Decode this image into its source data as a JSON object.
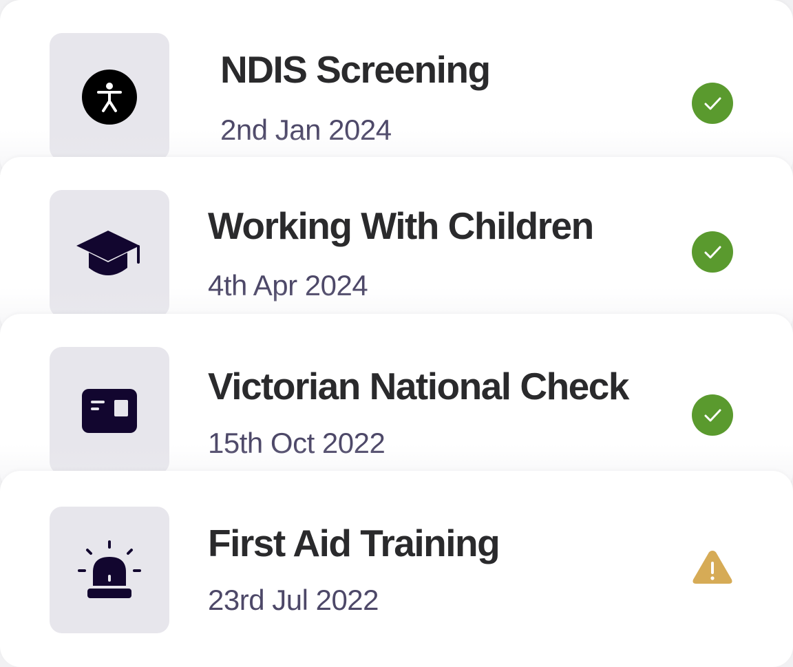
{
  "colors": {
    "ok": "#5a9a2e",
    "warning": "#d6ab56",
    "icon": "#12062f",
    "title": "#2a2a2c",
    "date": "#4d4868",
    "tile": "#e7e6ec"
  },
  "items": [
    {
      "title": "NDIS Screening",
      "date": "2nd Jan 2024",
      "icon": "accessibility-icon",
      "status": "ok"
    },
    {
      "title": "Working With Children",
      "date": "4th Apr 2024",
      "icon": "graduation-cap-icon",
      "status": "ok"
    },
    {
      "title": "Victorian National Check",
      "date": "15th Oct 2022",
      "icon": "id-card-icon",
      "status": "ok"
    },
    {
      "title": "First Aid Training",
      "date": "23rd Jul 2022",
      "icon": "siren-icon",
      "status": "warning"
    }
  ]
}
